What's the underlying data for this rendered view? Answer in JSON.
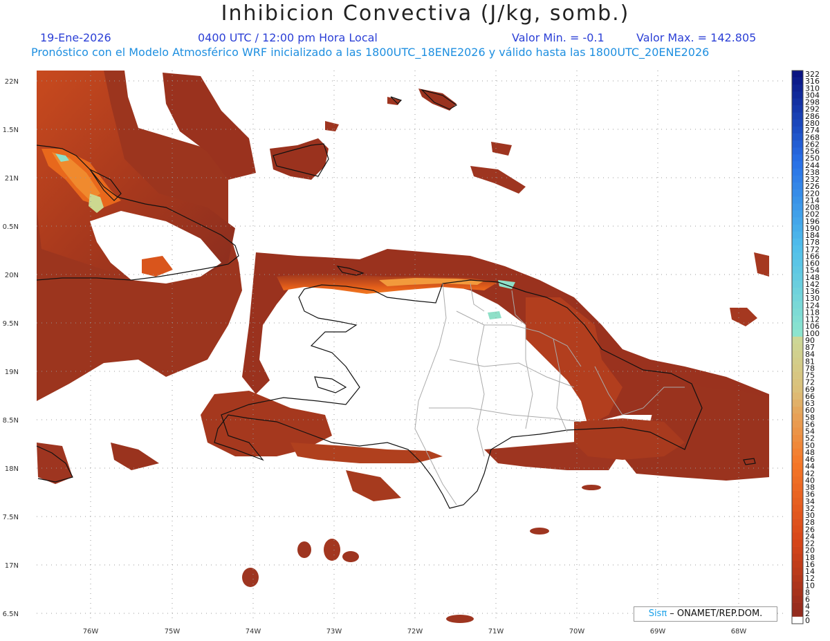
{
  "header": {
    "title": "Inhibicion Convectiva (J/kg, somb.)",
    "date": "19-Ene-2026",
    "time": "0400 UTC / 12:00 pm Hora Local",
    "valor_min": "Valor Min. = -0.1",
    "valor_max": "Valor Max. = 142.805",
    "model_line": "Pronóstico con el Modelo Atmosférico WRF inicializado a las 1800UTC_18ENE2026 y válido hasta las  1800UTC_20ENE2026"
  },
  "axes": {
    "lat_labels": [
      "22N",
      "1.5N",
      "21N",
      "0.5N",
      "20N",
      "9.5N",
      "19N",
      "8.5N",
      "18N",
      "7.5N",
      "17N",
      "6.5N"
    ],
    "lon_labels": [
      "76W",
      "75W",
      "74W",
      "73W",
      "72W",
      "71W",
      "70W",
      "69W",
      "68W"
    ]
  },
  "colorbar": {
    "labels": [
      "322",
      "316",
      "310",
      "304",
      "298",
      "292",
      "286",
      "280",
      "274",
      "268",
      "262",
      "256",
      "250",
      "244",
      "238",
      "232",
      "226",
      "220",
      "214",
      "208",
      "202",
      "196",
      "190",
      "184",
      "178",
      "172",
      "166",
      "160",
      "154",
      "148",
      "142",
      "136",
      "130",
      "124",
      "118",
      "112",
      "106",
      "100",
      "90",
      "87",
      "84",
      "81",
      "78",
      "75",
      "72",
      "69",
      "66",
      "63",
      "60",
      "58",
      "56",
      "54",
      "52",
      "50",
      "48",
      "46",
      "44",
      "42",
      "40",
      "38",
      "36",
      "34",
      "32",
      "30",
      "28",
      "26",
      "24",
      "22",
      "20",
      "18",
      "16",
      "14",
      "12",
      "10",
      "8",
      "6",
      "4",
      "2",
      "0"
    ]
  },
  "credit": {
    "brand": "Sisπ",
    "text": " – ONAMET/REP.DOM."
  },
  "colors": {
    "base_fill": "#8b2e1f",
    "mid_fill": "#c8441c",
    "high_fill": "#ee6a16",
    "peak_fill": "#ccd890",
    "top_fill": "#8fe0c8"
  }
}
